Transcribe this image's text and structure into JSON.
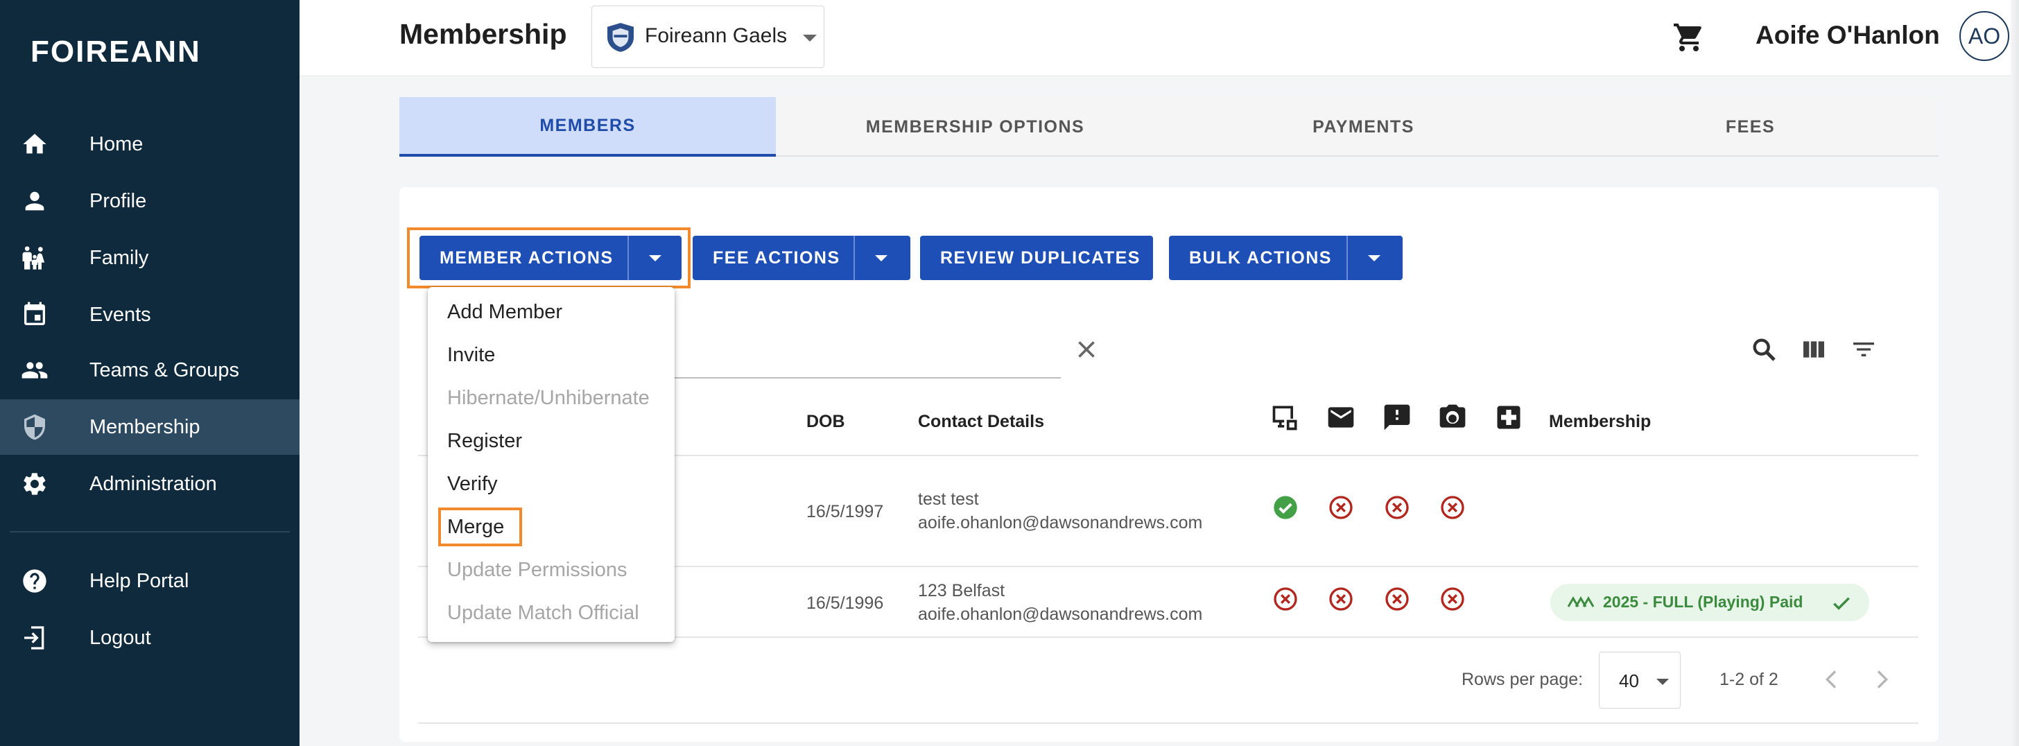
{
  "brand": {
    "logo": "FOIREANN"
  },
  "sidebar": {
    "items": [
      {
        "label": "Home",
        "icon": "home-icon"
      },
      {
        "label": "Profile",
        "icon": "person-icon"
      },
      {
        "label": "Family",
        "icon": "family-icon"
      },
      {
        "label": "Events",
        "icon": "calendar-icon"
      },
      {
        "label": "Teams & Groups",
        "icon": "group-icon"
      },
      {
        "label": "Membership",
        "icon": "shield-icon",
        "active": true
      },
      {
        "label": "Administration",
        "icon": "gear-icon"
      },
      {
        "label": "Help Portal",
        "icon": "help-icon"
      },
      {
        "label": "Logout",
        "icon": "logout-icon"
      }
    ]
  },
  "header": {
    "title": "Membership",
    "club": "Foireann Gaels",
    "user_name": "Aoife O'Hanlon",
    "user_initials": "AO"
  },
  "tabs": [
    {
      "label": "MEMBERS",
      "active": true
    },
    {
      "label": "MEMBERSHIP OPTIONS"
    },
    {
      "label": "PAYMENTS"
    },
    {
      "label": "FEES"
    }
  ],
  "toolbar": {
    "member_actions": "MEMBER ACTIONS",
    "fee_actions": "FEE ACTIONS",
    "review_duplicates": "REVIEW DUPLICATES",
    "bulk_actions": "BULK ACTIONS"
  },
  "member_actions_menu": [
    {
      "label": "Add Member",
      "enabled": true
    },
    {
      "label": "Invite",
      "enabled": true
    },
    {
      "label": "Hibernate/Unhibernate",
      "enabled": false
    },
    {
      "label": "Register",
      "enabled": true
    },
    {
      "label": "Verify",
      "enabled": true
    },
    {
      "label": "Merge",
      "enabled": true,
      "highlighted": true
    },
    {
      "label": "Update Permissions",
      "enabled": false
    },
    {
      "label": "Update Match Official",
      "enabled": false
    }
  ],
  "table": {
    "columns": {
      "dob": "DOB",
      "contact": "Contact Details",
      "membership": "Membership",
      "status_icons": [
        "online-access-icon",
        "email-icon",
        "alert-icon",
        "camera-icon",
        "medical-icon"
      ]
    },
    "rows": [
      {
        "dob": "16/5/1997",
        "contact_line1": "test test",
        "contact_line2": "aoife.ohanlon@dawsonandrews.com",
        "statuses": [
          "ok",
          "error",
          "error",
          "error"
        ],
        "membership": ""
      },
      {
        "dob": "16/5/1996",
        "contact_line1": "123 Belfast",
        "contact_line2": "aoife.ohanlon@dawsonandrews.com",
        "statuses": [
          "error",
          "error",
          "error",
          "error"
        ],
        "membership": "2025 - FULL (Playing) Paid"
      }
    ]
  },
  "pagination": {
    "rows_per_page_label": "Rows per page:",
    "rows_per_page": "40",
    "range": "1-2 of 2"
  },
  "colors": {
    "sidebar_bg": "#0f2a3d",
    "primary": "#1d4fb6",
    "highlight": "#f08a2c",
    "ok": "#43a047",
    "error": "#b3261e"
  }
}
